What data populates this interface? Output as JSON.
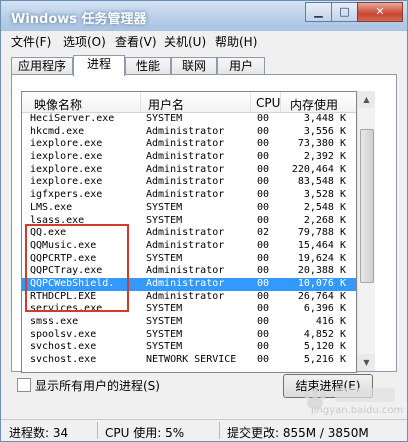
{
  "window": {
    "title": "Windows 任务管理器"
  },
  "menu": [
    "文件(F)",
    "选项(O)",
    "查看(V)",
    "关机(U)",
    "帮助(H)"
  ],
  "tabs": [
    "应用程序",
    "进程",
    "性能",
    "联网",
    "用户"
  ],
  "active_tab": "进程",
  "columns": {
    "name": "映像名称",
    "user": "用户名",
    "cpu": "CPU",
    "mem": "内存使用"
  },
  "processes": [
    {
      "name": "HeciServer.exe",
      "user": "SYSTEM",
      "cpu": "00",
      "mem": "3,448 K"
    },
    {
      "name": "hkcmd.exe",
      "user": "Administrator",
      "cpu": "00",
      "mem": "3,556 K"
    },
    {
      "name": "iexplore.exe",
      "user": "Administrator",
      "cpu": "00",
      "mem": "73,380 K"
    },
    {
      "name": "iexplore.exe",
      "user": "Administrator",
      "cpu": "00",
      "mem": "2,392 K"
    },
    {
      "name": "iexplore.exe",
      "user": "Administrator",
      "cpu": "00",
      "mem": "220,464 K"
    },
    {
      "name": "iexplore.exe",
      "user": "Administrator",
      "cpu": "00",
      "mem": "83,548 K"
    },
    {
      "name": "igfxpers.exe",
      "user": "Administrator",
      "cpu": "00",
      "mem": "3,528 K"
    },
    {
      "name": "LMS.exe",
      "user": "SYSTEM",
      "cpu": "00",
      "mem": "2,548 K"
    },
    {
      "name": "lsass.exe",
      "user": "SYSTEM",
      "cpu": "00",
      "mem": "2,268 K"
    },
    {
      "name": "QQ.exe",
      "user": "Administrator",
      "cpu": "02",
      "mem": "79,788 K"
    },
    {
      "name": "QQMusic.exe",
      "user": "Administrator",
      "cpu": "00",
      "mem": "15,464 K"
    },
    {
      "name": "QQPCRTP.exe",
      "user": "SYSTEM",
      "cpu": "00",
      "mem": "19,624 K"
    },
    {
      "name": "QQPCTray.exe",
      "user": "Administrator",
      "cpu": "00",
      "mem": "20,388 K"
    },
    {
      "name": "QQPCWebShield.",
      "user": "Administrator",
      "cpu": "00",
      "mem": "10,076 K",
      "selected": true
    },
    {
      "name": "RTHDCPL.EXE",
      "user": "Administrator",
      "cpu": "00",
      "mem": "26,764 K"
    },
    {
      "name": "services.exe",
      "user": "SYSTEM",
      "cpu": "00",
      "mem": "6,396 K"
    },
    {
      "name": "smss.exe",
      "user": "SYSTEM",
      "cpu": "00",
      "mem": "416 K"
    },
    {
      "name": "spoolsv.exe",
      "user": "SYSTEM",
      "cpu": "00",
      "mem": "4,852 K"
    },
    {
      "name": "svchost.exe",
      "user": "SYSTEM",
      "cpu": "00",
      "mem": "5,120 K"
    },
    {
      "name": "svchost.exe",
      "user": "NETWORK SERVICE",
      "cpu": "00",
      "mem": "5,216 K"
    }
  ],
  "show_all_users_label": "显示所有用户的进程(S)",
  "end_process_label": "结束进程(E)",
  "status": {
    "process_count": "进程数: 34",
    "cpu_usage": "CPU 使用: 5%",
    "commit": "提交更改: 855M / 3850M"
  },
  "watermark": {
    "text": "jingyan.baidu.com"
  },
  "colors": {
    "selection": "#3399ff",
    "highlight_border": "#d23a2a",
    "title_bar": "#b9cfe8"
  }
}
